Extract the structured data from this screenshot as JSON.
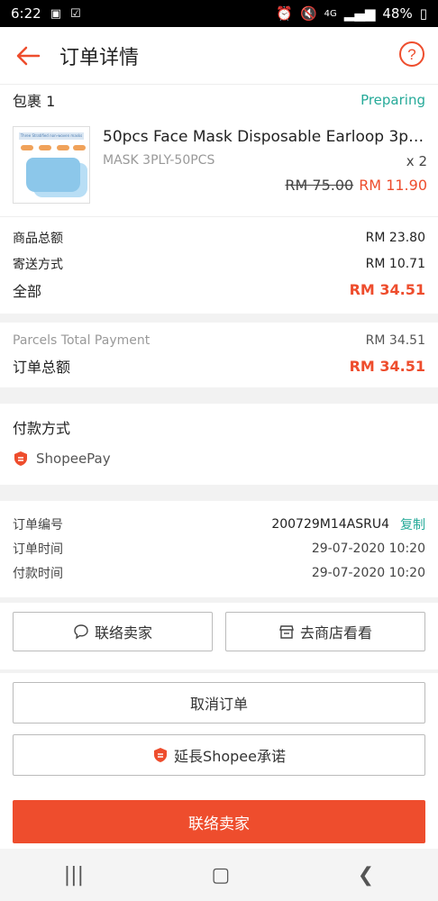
{
  "status_bar": {
    "time": "6:22",
    "battery": "48%",
    "network": "4G"
  },
  "header": {
    "title": "订单详情"
  },
  "package": {
    "label": "包裹 1",
    "status": "Preparing",
    "product": {
      "name": "50pcs Face Mask Disposable Earloop 3ply ...",
      "variation": "MASK 3PLY-50PCS",
      "quantity": "x 2",
      "original_price": "RM 75.00",
      "price": "RM 11.90"
    },
    "summary": [
      {
        "label": "商品总额",
        "value": "RM 23.80"
      },
      {
        "label": "寄送方式",
        "value": "RM 10.71"
      },
      {
        "label": "全部",
        "value": "RM 34.51"
      }
    ]
  },
  "totals": {
    "parcels_label": "Parcels Total Payment",
    "parcels_value": "RM 34.51",
    "order_total_label": "订单总额",
    "order_total_value": "RM 34.51"
  },
  "payment": {
    "label": "付款方式",
    "method": "ShopeePay"
  },
  "order_info": {
    "number_label": "订单编号",
    "number_value": "200729M14ASRU4",
    "copy_label": "复制",
    "order_time_label": "订单时间",
    "order_time_value": "29-07-2020 10:20",
    "pay_time_label": "付款时间",
    "pay_time_value": "29-07-2020 10:20"
  },
  "actions": {
    "contact_seller": "联络卖家",
    "visit_shop": "去商店看看",
    "cancel_order": "取消订单",
    "extend_guarantee": "延長Shopee承诺",
    "primary_contact": "联络卖家"
  },
  "thumbnail": {
    "caption": "Three Stratified non-woven masks"
  },
  "colors": {
    "accent": "#ee4d2d",
    "teal": "#26aa99"
  },
  "icons": [
    "back-arrow-icon",
    "help-icon",
    "shopee-shield-icon",
    "chat-icon",
    "shop-icon"
  ]
}
